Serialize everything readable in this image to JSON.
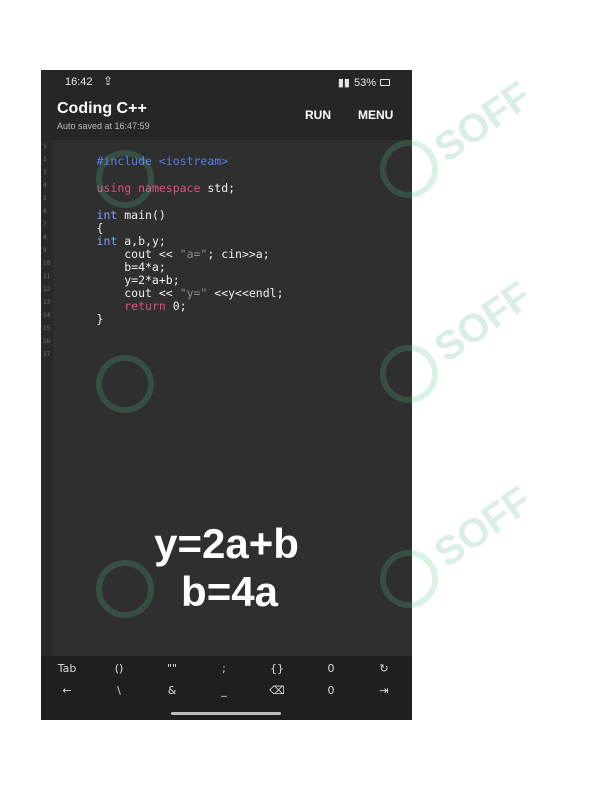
{
  "status": {
    "time": "16:42",
    "upload_icon": "⇪",
    "right_text": "53%",
    "signal_icon": "📶"
  },
  "app": {
    "title": "Coding C++",
    "subtitle": "Auto saved at 16:47:59",
    "run_label": "RUN",
    "menu_label": "MENU"
  },
  "editor": {
    "line_numbers": [
      "1",
      "2",
      "3",
      "4",
      "5",
      "6",
      "7",
      "8",
      "9",
      "10",
      "11",
      "12",
      "13",
      "14",
      "15",
      "16",
      "17"
    ],
    "lines": [
      {
        "pre": "#include",
        "rest": " <iostream>"
      },
      {
        "plain": ""
      },
      {
        "kw": "using",
        "kw2": " namespace",
        "rest": " std;"
      },
      {
        "plain": ""
      },
      {
        "type": "int",
        "rest": " main()"
      },
      {
        "plain": "{"
      },
      {
        "type": "int",
        "rest": " a,b,y;"
      },
      {
        "plain": "    cout << ",
        "str": "\"a=\"",
        "rest": "; cin>>a;"
      },
      {
        "plain": "    b=4*a;"
      },
      {
        "plain": "    y=2*a+b;"
      },
      {
        "plain": "    cout << ",
        "str": "\"y=\"",
        "rest": " <<y<<endl;"
      },
      {
        "indent": "    ",
        "kw": "return",
        "rest": " 0;"
      },
      {
        "plain": "}"
      }
    ]
  },
  "overlay": {
    "line1": "y=2a+b",
    "line2": "b=4a"
  },
  "keyboard": {
    "row1": [
      "Tab",
      "()",
      "\"\"",
      ";",
      "{}",
      "0",
      "↻"
    ],
    "row2": [
      "←",
      "\\",
      "&",
      "_",
      "⌫",
      "0",
      "⇥"
    ]
  },
  "watermark": {
    "text": "SOFF"
  }
}
